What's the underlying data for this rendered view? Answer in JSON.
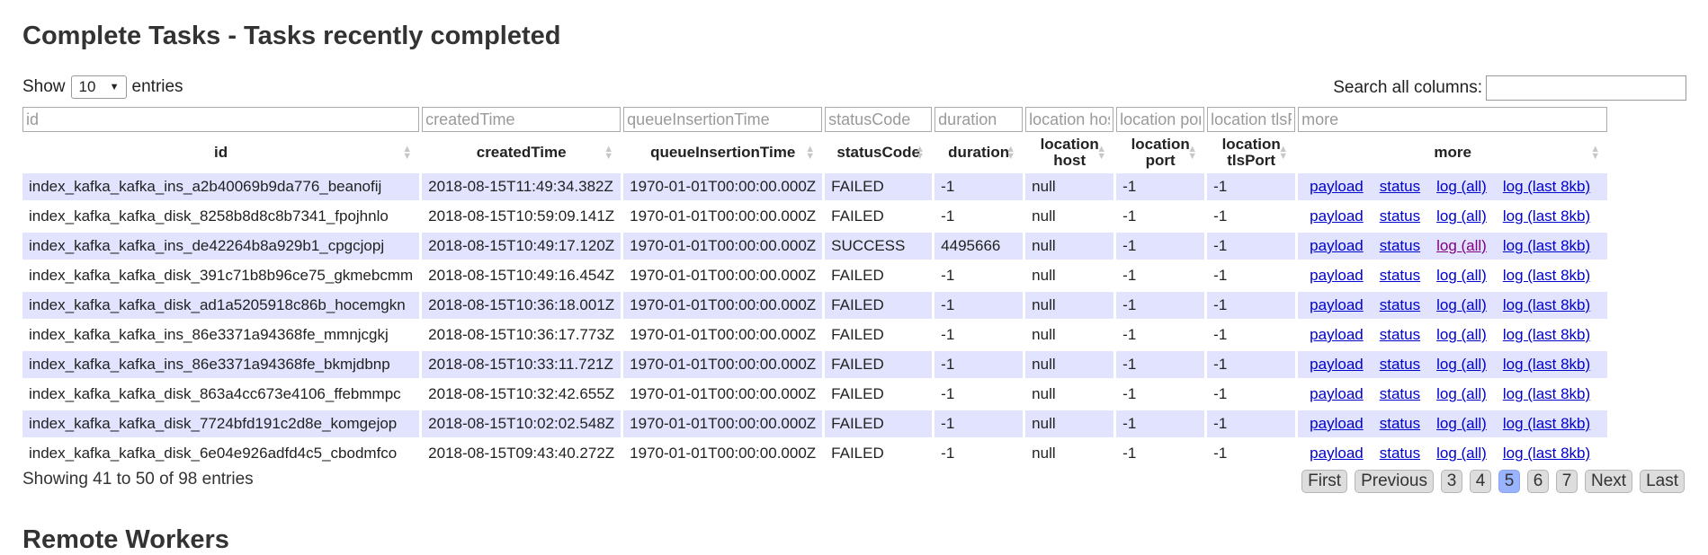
{
  "page": {
    "title": "Complete Tasks - Tasks recently completed",
    "next_section_title": "Remote Workers"
  },
  "length": {
    "show_label": "Show",
    "selected": "10",
    "entries_label": "entries"
  },
  "search": {
    "label": "Search all columns:",
    "value": ""
  },
  "filters": {
    "id": "id",
    "createdTime": "createdTime",
    "queueInsertionTime": "queueInsertionTime",
    "statusCode": "statusCode",
    "duration": "duration",
    "location_host": "location host",
    "location_port": "location port",
    "location_tlsPort": "location tlsPort",
    "more": "more"
  },
  "columns": {
    "id": "id",
    "createdTime": "createdTime",
    "queueInsertionTime": "queueInsertionTime",
    "statusCode": "statusCode",
    "duration": "duration",
    "location_host": "location host",
    "location_port": "location port",
    "location_tlsPort": "location tlsPort",
    "more": "more"
  },
  "links": {
    "payload": "payload",
    "status": "status",
    "log_all": "log (all)",
    "log_last": "log (last 8kb)"
  },
  "rows": [
    {
      "id": "index_kafka_kafka_ins_a2b40069b9da776_beanofij",
      "createdTime": "2018-08-15T11:49:34.382Z",
      "queueInsertionTime": "1970-01-01T00:00:00.000Z",
      "statusCode": "FAILED",
      "duration": "-1",
      "host": "null",
      "port": "-1",
      "tlsPort": "-1"
    },
    {
      "id": "index_kafka_kafka_disk_8258b8d8c8b7341_fpojhnlo",
      "createdTime": "2018-08-15T10:59:09.141Z",
      "queueInsertionTime": "1970-01-01T00:00:00.000Z",
      "statusCode": "FAILED",
      "duration": "-1",
      "host": "null",
      "port": "-1",
      "tlsPort": "-1"
    },
    {
      "id": "index_kafka_kafka_ins_de42264b8a929b1_cpgcjopj",
      "createdTime": "2018-08-15T10:49:17.120Z",
      "queueInsertionTime": "1970-01-01T00:00:00.000Z",
      "statusCode": "SUCCESS",
      "duration": "4495666",
      "host": "null",
      "port": "-1",
      "tlsPort": "-1"
    },
    {
      "id": "index_kafka_kafka_disk_391c71b8b96ce75_gkmebcmm",
      "createdTime": "2018-08-15T10:49:16.454Z",
      "queueInsertionTime": "1970-01-01T00:00:00.000Z",
      "statusCode": "FAILED",
      "duration": "-1",
      "host": "null",
      "port": "-1",
      "tlsPort": "-1"
    },
    {
      "id": "index_kafka_kafka_disk_ad1a5205918c86b_hocemgkn",
      "createdTime": "2018-08-15T10:36:18.001Z",
      "queueInsertionTime": "1970-01-01T00:00:00.000Z",
      "statusCode": "FAILED",
      "duration": "-1",
      "host": "null",
      "port": "-1",
      "tlsPort": "-1"
    },
    {
      "id": "index_kafka_kafka_ins_86e3371a94368fe_mmnjcgkj",
      "createdTime": "2018-08-15T10:36:17.773Z",
      "queueInsertionTime": "1970-01-01T00:00:00.000Z",
      "statusCode": "FAILED",
      "duration": "-1",
      "host": "null",
      "port": "-1",
      "tlsPort": "-1"
    },
    {
      "id": "index_kafka_kafka_ins_86e3371a94368fe_bkmjdbnp",
      "createdTime": "2018-08-15T10:33:11.721Z",
      "queueInsertionTime": "1970-01-01T00:00:00.000Z",
      "statusCode": "FAILED",
      "duration": "-1",
      "host": "null",
      "port": "-1",
      "tlsPort": "-1"
    },
    {
      "id": "index_kafka_kafka_disk_863a4cc673e4106_ffebmmpc",
      "createdTime": "2018-08-15T10:32:42.655Z",
      "queueInsertionTime": "1970-01-01T00:00:00.000Z",
      "statusCode": "FAILED",
      "duration": "-1",
      "host": "null",
      "port": "-1",
      "tlsPort": "-1"
    },
    {
      "id": "index_kafka_kafka_disk_7724bfd191c2d8e_komgejop",
      "createdTime": "2018-08-15T10:02:02.548Z",
      "queueInsertionTime": "1970-01-01T00:00:00.000Z",
      "statusCode": "FAILED",
      "duration": "-1",
      "host": "null",
      "port": "-1",
      "tlsPort": "-1"
    },
    {
      "id": "index_kafka_kafka_disk_6e04e926adfd4c5_cbodmfco",
      "createdTime": "2018-08-15T09:43:40.272Z",
      "queueInsertionTime": "1970-01-01T00:00:00.000Z",
      "statusCode": "FAILED",
      "duration": "-1",
      "host": "null",
      "port": "-1",
      "tlsPort": "-1"
    }
  ],
  "info": "Showing 41 to 50 of 98 entries",
  "pager": {
    "first": "First",
    "previous": "Previous",
    "pages": [
      "3",
      "4",
      "5",
      "6",
      "7"
    ],
    "active_page": "5",
    "next": "Next",
    "last": "Last"
  },
  "colors": {
    "odd_row": "#e2e4ff",
    "even_row": "#ffffff",
    "link": "#0000cc",
    "visited_link": "#800080",
    "active_page": "#99b3ff"
  }
}
